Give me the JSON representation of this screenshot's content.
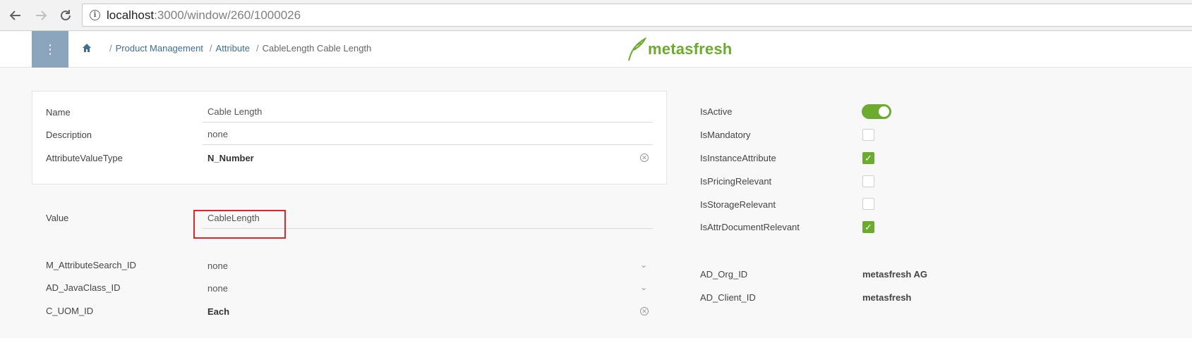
{
  "browser": {
    "url_host": "localhost",
    "url_path": ":3000/window/260/1000026"
  },
  "header": {
    "breadcrumb": [
      "Product Management",
      "Attribute",
      "CableLength Cable Length"
    ],
    "logo_text": "metasfresh",
    "accent_color": "#6bab2e"
  },
  "main": {
    "name_label": "Name",
    "name_value": "Cable Length",
    "description_label": "Description",
    "description_value": "none",
    "avt_label": "AttributeValueType",
    "avt_value": "N_Number",
    "value_label": "Value",
    "value_value": "CableLength",
    "search_label": "M_AttributeSearch_ID",
    "search_value": "none",
    "javaclass_label": "AD_JavaClass_ID",
    "javaclass_value": "none",
    "uom_label": "C_UOM_ID",
    "uom_value": "Each"
  },
  "flags": {
    "isactive_label": "IsActive",
    "ismandatory_label": "IsMandatory",
    "isinstance_label": "IsInstanceAttribute",
    "ispricing_label": "IsPricingRelevant",
    "isstorage_label": "IsStorageRelevant",
    "isattrdoc_label": "IsAttrDocumentRelevant",
    "isactive": true,
    "ismandatory": false,
    "isinstance": true,
    "ispricing": false,
    "isstorage": false,
    "isattrdoc": true
  },
  "org": {
    "org_label": "AD_Org_ID",
    "org_value": "metasfresh AG",
    "client_label": "AD_Client_ID",
    "client_value": "metasfresh"
  }
}
